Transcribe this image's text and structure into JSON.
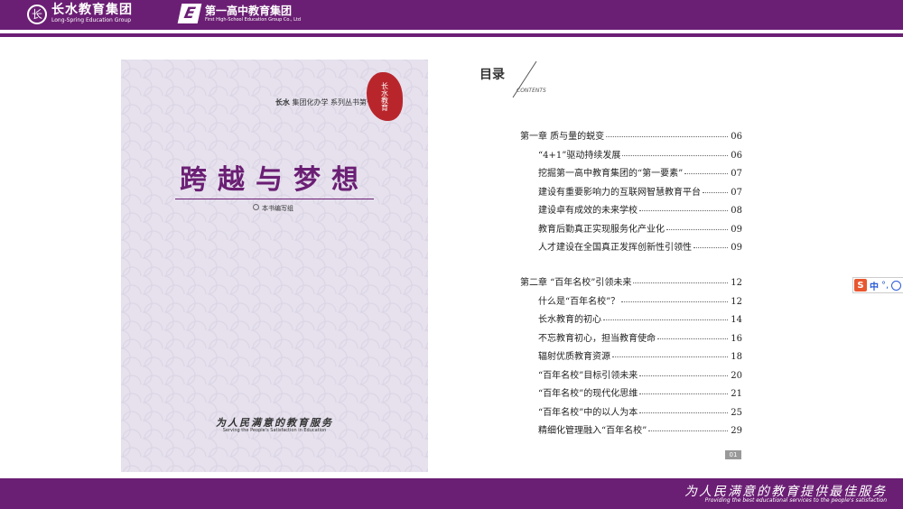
{
  "header": {
    "logo1_mark": "长",
    "logo1_cn": "长水教育集团",
    "logo1_en": "Long-Spring Education Group",
    "logo2_mark": "E",
    "logo2_cn": "第一高中教育集团",
    "logo2_en": "First High-School Education Group Co., Ltd"
  },
  "cover": {
    "series_brand": "长水",
    "series_text": "集团化办学 系列丛书第一册",
    "seal_text": "长水教育",
    "title": "跨越与梦想",
    "author": "本书编写组",
    "slogan_cn": "为人民满意的教育服务",
    "slogan_en": "Serving the People's Satisfaction in Education"
  },
  "toc": {
    "title": "目录",
    "subtitle": "CONTENTS",
    "chapter1": [
      {
        "label": "第一章   质与量的蜕变",
        "page": "06"
      },
      {
        "label": "“4+1”驱动持续发展",
        "page": "06"
      },
      {
        "label": "挖掘第一高中教育集团的“第一要素”",
        "page": "07"
      },
      {
        "label": "建设有重要影响力的互联网智慧教育平台",
        "page": "07"
      },
      {
        "label": "建设卓有成效的未来学校",
        "page": "08"
      },
      {
        "label": "教育后勤真正实现服务化产业化",
        "page": "09"
      },
      {
        "label": "人才建设在全国真正发挥创新性引领性",
        "page": "09"
      }
    ],
    "chapter2": [
      {
        "label": "第二章   “百年名校”引领未来",
        "page": "12"
      },
      {
        "label": "什么是“百年名校”？",
        "page": "12"
      },
      {
        "label": "长水教育的初心",
        "page": "14"
      },
      {
        "label": "不忘教育初心，担当教育使命",
        "page": "16"
      },
      {
        "label": "辐射优质教育资源",
        "page": "18"
      },
      {
        "label": "“百年名校”目标引领未来",
        "page": "20"
      },
      {
        "label": "“百年名校”的现代化思维",
        "page": "21"
      },
      {
        "label": "“百年名校”中的以人为本",
        "page": "25"
      },
      {
        "label": "精细化管理融入“百年名校”",
        "page": "29"
      }
    ],
    "page_number": "01"
  },
  "ime": {
    "s": "S",
    "z": "中",
    "p": "°,"
  },
  "footer": {
    "slogan_cn": "为人民满意的教育提供最佳服务",
    "slogan_en": "Providing the best educational services to the people's satisfaction"
  }
}
